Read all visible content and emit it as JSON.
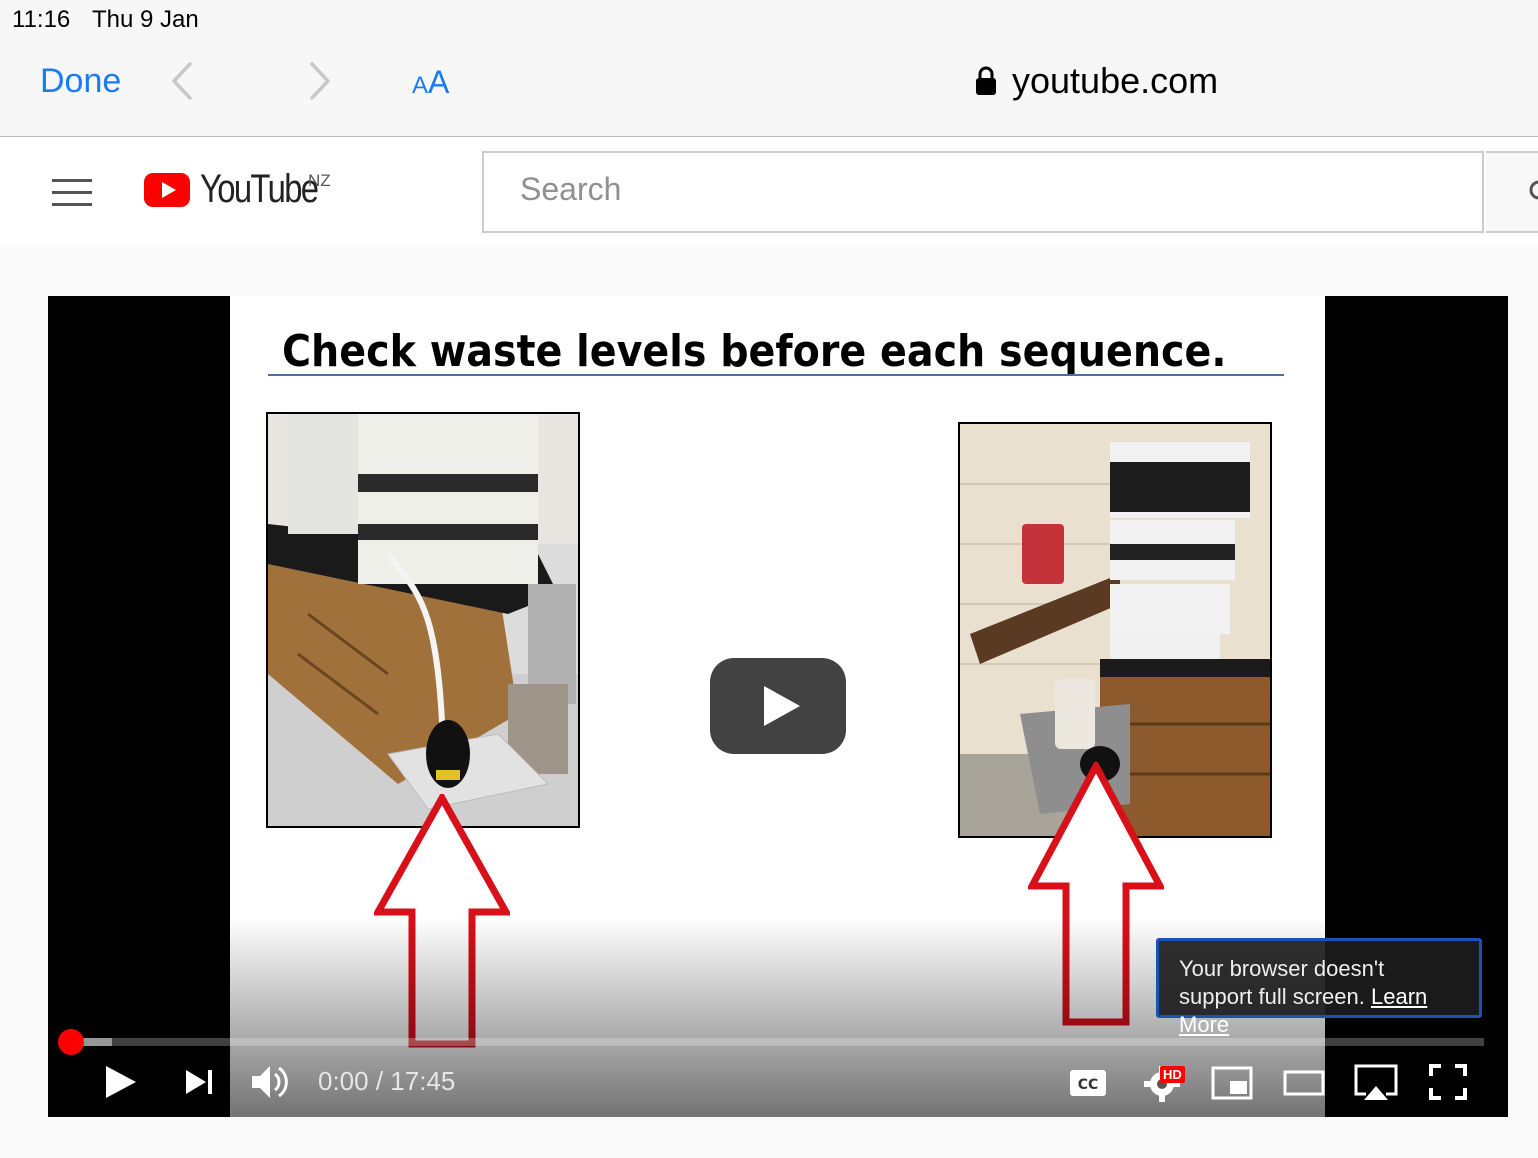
{
  "status_bar": {
    "time": "11:16",
    "date": "Thu 9 Jan"
  },
  "safari": {
    "done_label": "Done",
    "text_size_small": "A",
    "text_size_large": "A",
    "url": "youtube.com",
    "icons": [
      "chevron-left-icon",
      "chevron-right-icon",
      "lock-icon"
    ],
    "accent_color": "#1b7cf2"
  },
  "youtube": {
    "logo_text": "YouTube",
    "country_code": "NZ",
    "search_placeholder": "Search",
    "brand_color": "#ff0000"
  },
  "video": {
    "slide_title": "Check waste levels before each sequence.",
    "time_current": "0:00",
    "time_separator": " / ",
    "time_total": "17:45",
    "quality_badge": "HD",
    "progress_fraction": 0,
    "tooltip_text": "Your browser doesn't support full screen.",
    "tooltip_link": "Learn More",
    "icons": [
      "play-icon",
      "next-icon",
      "volume-icon",
      "captions-icon",
      "settings-icon",
      "miniplayer-icon",
      "theater-icon",
      "airplay-icon",
      "fullscreen-icon"
    ]
  }
}
